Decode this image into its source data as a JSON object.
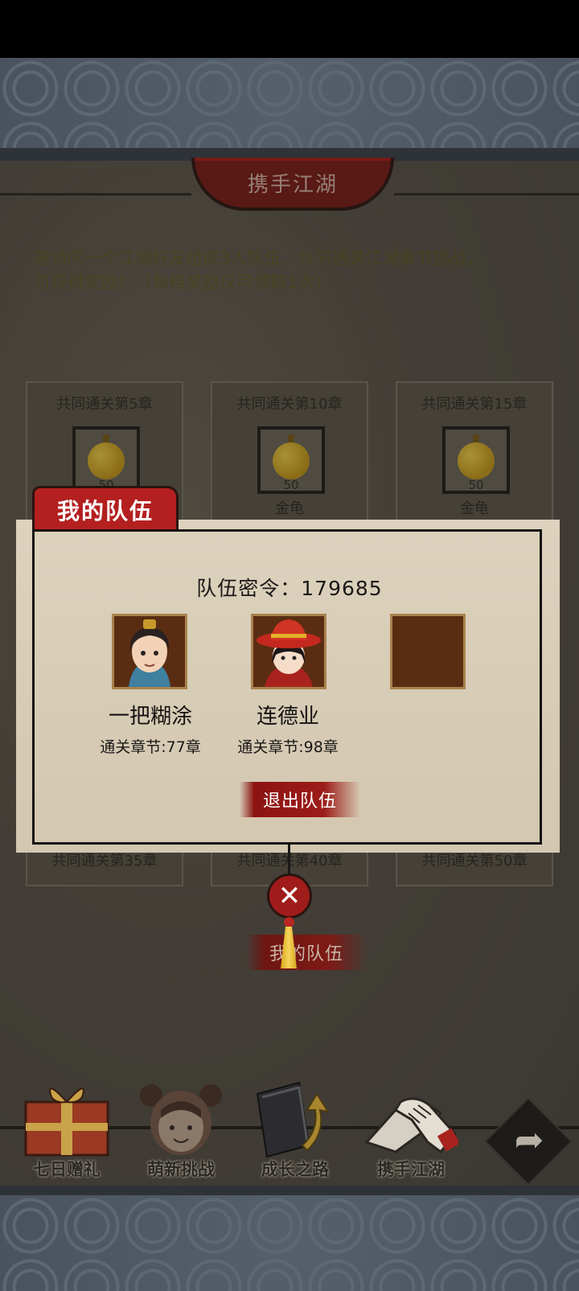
{
  "header": {
    "title": "携手江湖"
  },
  "intro": {
    "line1": "邀请同一个江湖好友组成3人队伍，共同通关江湖章节挑战，",
    "line2": "可获得奖励！（每档奖励仅可领取1次）"
  },
  "rewards_row1": [
    {
      "title": "共同通关第5章",
      "qty": "50",
      "name": ""
    },
    {
      "title": "共同通关第10章",
      "qty": "50",
      "name": "金龟"
    },
    {
      "title": "共同通关第15章",
      "qty": "50",
      "name": "金龟"
    }
  ],
  "rewards_row2": [
    {
      "title": "共同通关第35章"
    },
    {
      "title": "共同通关第40章"
    },
    {
      "title": "共同通关第50章"
    }
  ],
  "dialog": {
    "tab_label": "我的队伍",
    "team_code_label": "队伍密令：",
    "team_code": "179685",
    "members": [
      {
        "name": "一把糊涂",
        "progress": "通关章节:77章"
      },
      {
        "name": "连德业",
        "progress": "通关章节:98章"
      }
    ],
    "leave_label": "退出队伍",
    "close_glyph": "✕"
  },
  "my_team_label": "我的队伍",
  "nav": [
    {
      "label": "七日赠礼",
      "icon": "gift-box-icon"
    },
    {
      "label": "萌新挑战",
      "icon": "girl-face-icon"
    },
    {
      "label": "成长之路",
      "icon": "book-arrow-icon"
    },
    {
      "label": "携手江湖",
      "icon": "handshake-icon"
    }
  ],
  "colors": {
    "accent_red": "#b3201f",
    "parchment": "#ddd2bd",
    "gold": "#f3d24a"
  }
}
